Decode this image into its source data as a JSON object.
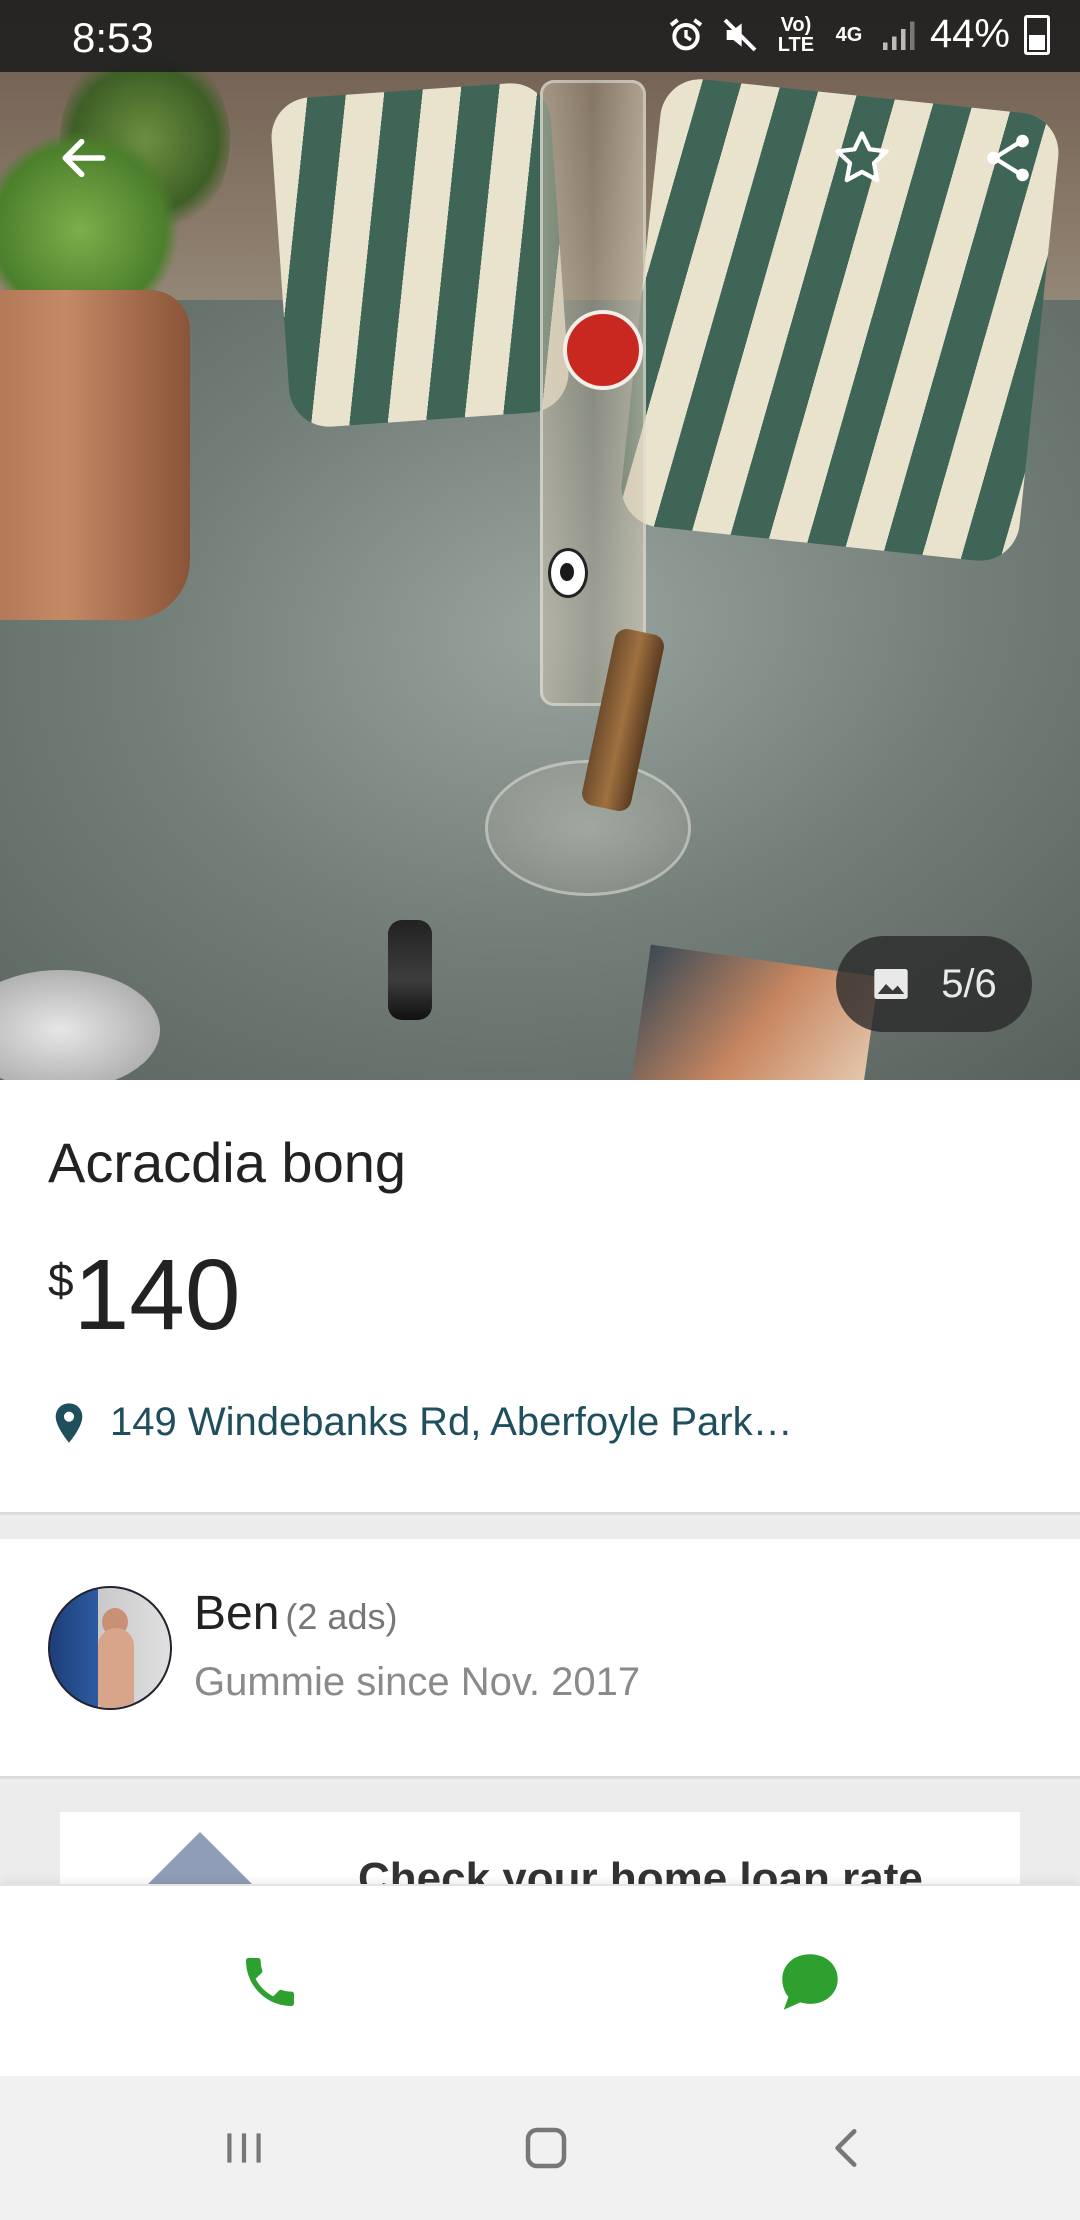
{
  "status_bar": {
    "time": "8:53",
    "network_volte": "Vo) LTE",
    "network_4g": "4G",
    "battery": "44%"
  },
  "gallery": {
    "counter": "5/6"
  },
  "listing": {
    "title": "Acracdia bong",
    "currency": "$",
    "price": "140",
    "location": "149 Windebanks Rd, Aberfoyle Park…"
  },
  "seller": {
    "name": "Ben",
    "ads": "(2 ads)",
    "since": "Gummie since Nov. 2017"
  },
  "ad_banner": {
    "text": "Check your home loan rate"
  },
  "actions": {
    "call_icon": "phone-icon",
    "chat_icon": "chat-bubble-icon",
    "accent_color": "#2ea02f"
  },
  "colors": {
    "location_text": "#1f4f5d",
    "muted_text": "#8a8a8a"
  }
}
